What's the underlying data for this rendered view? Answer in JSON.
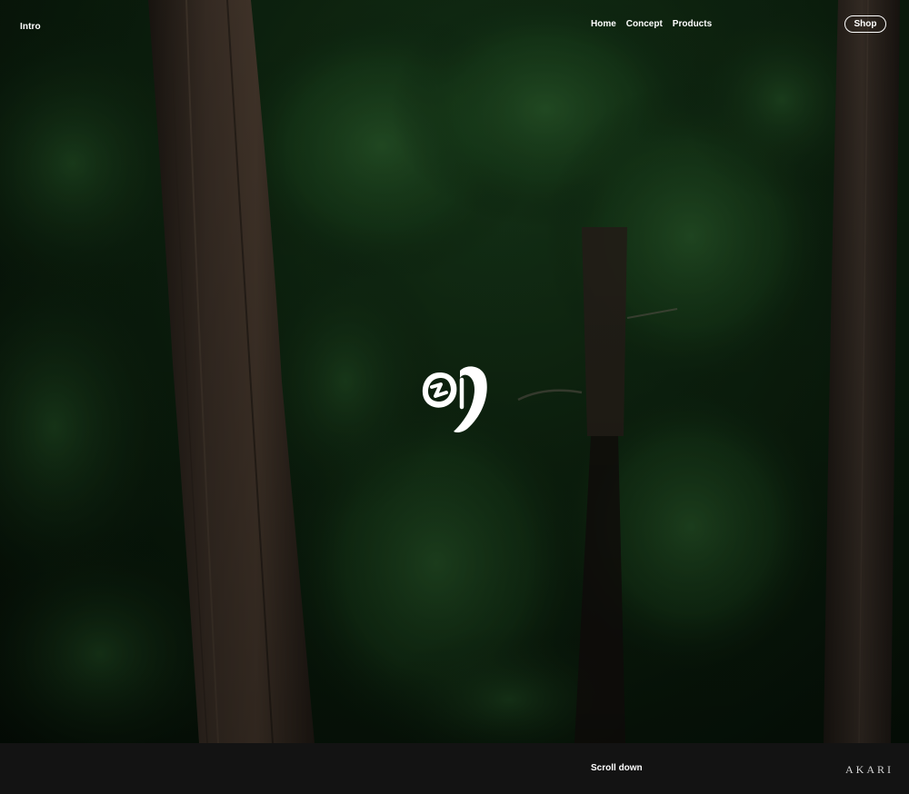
{
  "header": {
    "intro_label": "Intro",
    "nav": [
      {
        "label": "Home"
      },
      {
        "label": "Concept"
      },
      {
        "label": "Products"
      }
    ],
    "shop_label": "Shop"
  },
  "hero": {
    "background": "dark cedar forest photograph",
    "logo_icon": "brush-stroke-logo-icon"
  },
  "footer": {
    "scroll_label": "Scroll down",
    "brand": "AKARI"
  },
  "colors": {
    "text": "#ffffff",
    "footer_bg": "#131313",
    "forest_dark": "#081a0a",
    "foliage": "#1e4a22"
  }
}
